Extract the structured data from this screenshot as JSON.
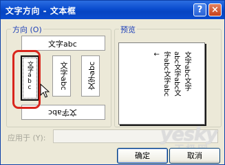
{
  "window": {
    "title": "文字方向 - 文本框",
    "help_label": "?",
    "close_label": "×"
  },
  "orientation": {
    "legend": "方向 (O)",
    "options": [
      {
        "label": "文字abc",
        "direction": "horizontal-top"
      },
      {
        "label": "文字abc",
        "direction": "vertical-stacked",
        "selected": true
      },
      {
        "label": "文字abc",
        "direction": "vertical-rotated-right"
      },
      {
        "label": "文字abc",
        "direction": "vertical-rotated-left"
      },
      {
        "label": "文字abc",
        "direction": "horizontal-bottom-flipped"
      }
    ]
  },
  "preview": {
    "legend": "预览",
    "lines": [
      "文字abc文字",
      "abc文字abc文",
      "字abc文字abc",
      "↓"
    ]
  },
  "apply_to": {
    "label": "应用于 (Y):",
    "value": ""
  },
  "buttons": {
    "ok": "确定",
    "cancel": "取消"
  },
  "watermark": {
    "text": "yesky",
    "subtext": "天极网"
  }
}
